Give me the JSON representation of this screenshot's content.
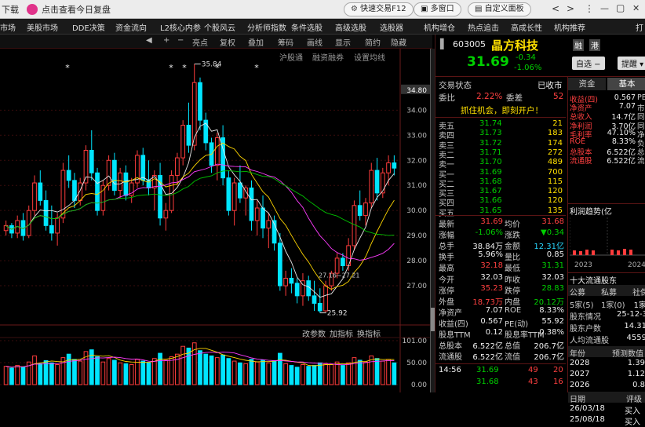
{
  "topbar": {
    "left_label": "下载",
    "promo_text": "点击查看今日复盘",
    "quick_trade": "快速交易F12",
    "multi_window": "多窗口",
    "custom_panel": "自定义面板",
    "nav_back": "<",
    "nav_fwd": ">",
    "more": "⋮",
    "minimize": "—",
    "restore": "▢",
    "close": "✕"
  },
  "menubar": {
    "items": [
      "市场",
      "美股市场",
      "DDE决策",
      "资金流向",
      "L2核心内参",
      "个股风云",
      "分析师指数",
      "条件选股",
      "高级选股",
      "选股器",
      "机构增仓",
      "热点追击",
      "高成长性",
      "机构推荐",
      "打"
    ]
  },
  "chart_toolbar": {
    "left_arrow": "◀",
    "plus": "+",
    "minus": "−",
    "bright_point": "亮点",
    "adjust": "复权",
    "overlay": "叠加",
    "chips": "筹码",
    "draw_line": "画线",
    "display": "显示",
    "simplified": "简约",
    "hide_indicator": "隐藏"
  },
  "chart_subbar": {
    "sh_connect": "沪股通",
    "margin_trading": "融资融券",
    "set_ma": "设置均线"
  },
  "chart_annotations": {
    "high_label": "35.84",
    "low_label": "25.92",
    "range_label": "27.16~27.21",
    "markers": [
      "*",
      "*",
      "*",
      "*",
      "*"
    ]
  },
  "indicator_bar": {
    "change_params": "改参数",
    "add_indicator": "加指标",
    "switch_indicator": "换指标"
  },
  "chart_data": {
    "type": "candlestick",
    "y_axis_price": [
      "34.80",
      "34.00",
      "33.00",
      "32.00",
      "31.00",
      "30.00",
      "29.00",
      "28.00",
      "27.00"
    ],
    "y_axis_volume": [
      "101.00",
      "50.00",
      "0.00"
    ],
    "current_price_tag": "34.80",
    "ylim": [
      25.5,
      35.2
    ],
    "candles": [
      [
        29.2,
        29.6,
        29.0,
        29.4
      ],
      [
        29.4,
        29.5,
        28.9,
        29.1
      ],
      [
        29.1,
        29.8,
        28.9,
        29.6
      ],
      [
        29.6,
        29.9,
        28.8,
        29.0
      ],
      [
        29.0,
        30.2,
        28.9,
        30.0
      ],
      [
        30.0,
        31.4,
        29.8,
        31.1
      ],
      [
        31.1,
        31.6,
        30.2,
        30.4
      ],
      [
        30.4,
        30.8,
        29.2,
        29.4
      ],
      [
        29.4,
        30.2,
        28.8,
        29.1
      ],
      [
        29.1,
        29.9,
        28.6,
        29.7
      ],
      [
        29.7,
        31.9,
        29.5,
        31.6
      ],
      [
        31.6,
        32.2,
        30.9,
        31.2
      ],
      [
        31.2,
        31.5,
        30.1,
        30.4
      ],
      [
        30.4,
        31.3,
        30.2,
        31.1
      ],
      [
        31.1,
        32.6,
        30.8,
        32.4
      ],
      [
        32.4,
        33.2,
        31.2,
        31.5
      ],
      [
        31.5,
        31.7,
        29.8,
        30.0
      ],
      [
        30.0,
        31.2,
        29.8,
        31.0
      ],
      [
        31.0,
        32.2,
        30.8,
        32.0
      ],
      [
        32.0,
        32.3,
        30.6,
        30.8
      ],
      [
        30.8,
        31.7,
        30.5,
        31.5
      ],
      [
        31.5,
        31.8,
        30.4,
        30.6
      ],
      [
        30.6,
        31.3,
        30.3,
        31.1
      ],
      [
        31.1,
        32.4,
        30.9,
        32.2
      ],
      [
        32.2,
        32.5,
        31.0,
        31.2
      ],
      [
        31.2,
        32.0,
        30.6,
        30.9
      ],
      [
        30.9,
        31.6,
        30.0,
        31.4
      ],
      [
        31.4,
        31.9,
        29.4,
        29.7
      ],
      [
        29.7,
        30.3,
        29.2,
        30.0
      ],
      [
        30.0,
        31.6,
        29.9,
        31.4
      ],
      [
        31.4,
        32.3,
        31.0,
        32.1
      ],
      [
        32.1,
        33.6,
        31.8,
        33.4
      ],
      [
        33.4,
        34.3,
        32.3,
        32.6
      ],
      [
        32.6,
        35.84,
        32.4,
        35.1
      ],
      [
        35.1,
        35.3,
        33.2,
        33.6
      ],
      [
        33.6,
        33.9,
        32.4,
        32.7
      ],
      [
        32.7,
        32.9,
        31.5,
        31.8
      ],
      [
        31.8,
        33.1,
        31.2,
        32.9
      ],
      [
        32.9,
        33.4,
        31.0,
        31.3
      ],
      [
        31.3,
        31.6,
        29.8,
        30.0
      ],
      [
        30.0,
        31.3,
        29.4,
        31.1
      ],
      [
        31.1,
        31.8,
        30.3,
        30.5
      ],
      [
        30.5,
        31.0,
        29.8,
        30.9
      ],
      [
        30.9,
        31.2,
        29.2,
        29.6
      ],
      [
        29.6,
        30.4,
        29.0,
        30.1
      ],
      [
        30.1,
        30.6,
        28.9,
        29.3
      ],
      [
        29.3,
        29.9,
        28.5,
        29.6
      ],
      [
        29.6,
        29.8,
        28.4,
        28.7
      ],
      [
        28.7,
        29.1,
        26.8,
        27.0
      ],
      [
        27.0,
        27.6,
        26.6,
        27.3
      ],
      [
        27.3,
        27.7,
        26.7,
        27.1
      ],
      [
        27.1,
        27.3,
        26.3,
        26.6
      ],
      [
        26.6,
        27.5,
        26.2,
        27.2
      ],
      [
        27.2,
        27.4,
        26.4,
        26.6
      ],
      [
        26.6,
        27.2,
        26.0,
        26.3
      ],
      [
        26.3,
        26.9,
        25.92,
        26.0
      ],
      [
        26.0,
        27.2,
        25.95,
        27.0
      ],
      [
        27.0,
        27.6,
        26.8,
        27.5
      ],
      [
        27.5,
        28.3,
        27.3,
        28.1
      ],
      [
        28.1,
        28.3,
        27.6,
        27.8
      ],
      [
        27.8,
        28.9,
        27.6,
        28.6
      ],
      [
        28.6,
        30.4,
        28.4,
        30.2
      ],
      [
        30.2,
        30.8,
        29.6,
        29.8
      ],
      [
        29.8,
        30.5,
        29.4,
        30.3
      ],
      [
        30.3,
        31.9,
        30.1,
        31.6
      ],
      [
        31.6,
        32.1,
        30.4,
        30.7
      ],
      [
        30.7,
        31.7,
        30.5,
        31.5
      ],
      [
        31.5,
        32.2,
        31.0,
        31.9
      ],
      [
        31.9,
        32.2,
        31.4,
        31.69
      ]
    ],
    "volumes": [
      42,
      38,
      44,
      40,
      52,
      66,
      48,
      55,
      50,
      46,
      62,
      70,
      58,
      54,
      76,
      80,
      64,
      52,
      60,
      56,
      50,
      48,
      46,
      58,
      54,
      50,
      60,
      72,
      56,
      64,
      70,
      88,
      84,
      96,
      78,
      70,
      66,
      62,
      68,
      60,
      54,
      50,
      48,
      58,
      52,
      56,
      50,
      54,
      72,
      48,
      44,
      40,
      46,
      42,
      44,
      50,
      48,
      46,
      52,
      44,
      50,
      62,
      56,
      52,
      66,
      60,
      54,
      58,
      50
    ]
  },
  "stock": {
    "code": "603005",
    "name": "晶方科技",
    "tag_rong": "融",
    "tag_hk": "港",
    "price": "31.69",
    "change": "-0.34",
    "change_pct": "-1.06%",
    "watch_btn": "自选 −",
    "remind_btn": "提醒 ▾",
    "trade_status_label": "交易状态",
    "trade_status": "已收市",
    "weibi_label": "委比",
    "weibi": "2.22%",
    "weicha_label": "委差",
    "weicha": "52",
    "promo": "抓住机会，即刻开户！"
  },
  "order_book": [
    {
      "label": "卖五",
      "price": "31.74",
      "vol": "21"
    },
    {
      "label": "卖四",
      "price": "31.73",
      "vol": "183"
    },
    {
      "label": "卖三",
      "price": "31.72",
      "vol": "174"
    },
    {
      "label": "卖二",
      "price": "31.71",
      "vol": "272"
    },
    {
      "label": "卖一",
      "price": "31.70",
      "vol": "489"
    },
    {
      "label": "买一",
      "price": "31.69",
      "vol": "700"
    },
    {
      "label": "买二",
      "price": "31.68",
      "vol": "115"
    },
    {
      "label": "买三",
      "price": "31.67",
      "vol": "120"
    },
    {
      "label": "买四",
      "price": "31.66",
      "vol": "120"
    },
    {
      "label": "买五",
      "price": "31.65",
      "vol": "135"
    }
  ],
  "quote_rows": [
    {
      "l1": "最新",
      "v1": "31.69",
      "c1": "red",
      "l2": "均价",
      "v2": "31.68",
      "c2": "red"
    },
    {
      "l1": "涨幅",
      "v1": "-1.06%",
      "c1": "grn",
      "l2": "涨跌",
      "v2": "▼0.34",
      "c2": "grn"
    },
    {
      "l1": "总手",
      "v1": "38.84万",
      "c1": "wht",
      "l2": "金额",
      "v2": "12.31亿",
      "c2": "cyan"
    },
    {
      "l1": "换手",
      "v1": "5.96%",
      "c1": "wht",
      "l2": "量比",
      "v2": "0.85",
      "c2": "wht"
    },
    {
      "l1": "最高",
      "v1": "32.18",
      "c1": "red",
      "l2": "最低",
      "v2": "31.31",
      "c2": "grn"
    },
    {
      "l1": "今开",
      "v1": "32.03",
      "c1": "wht",
      "l2": "昨收",
      "v2": "32.03",
      "c2": "wht"
    },
    {
      "l1": "涨停",
      "v1": "35.23",
      "c1": "red",
      "l2": "跌停",
      "v2": "28.83",
      "c2": "grn"
    },
    {
      "l1": "外盘",
      "v1": "18.73万",
      "c1": "red",
      "l2": "内盘",
      "v2": "20.12万",
      "c2": "grn"
    },
    {
      "l1": "净资产",
      "v1": "7.07",
      "c1": "wht",
      "l2": "ROE",
      "v2": "8.33%",
      "c2": "wht"
    },
    {
      "l1": "收益(四)",
      "v1": "0.567",
      "c1": "wht",
      "l2": "PE(动)",
      "v2": "55.92",
      "c2": "wht"
    },
    {
      "l1": "股息TTM",
      "v1": "0.12",
      "c1": "wht",
      "l2": "股息率TTM",
      "v2": "0.38%",
      "c2": "wht"
    },
    {
      "l1": "总股本",
      "v1": "6.522亿",
      "c1": "wht",
      "l2": "总值",
      "v2": "206.7亿",
      "c2": "wht"
    },
    {
      "l1": "流通股",
      "v1": "6.522亿",
      "c1": "wht",
      "l2": "流值",
      "v2": "206.7亿",
      "c2": "wht"
    }
  ],
  "ticks": [
    {
      "time": "14:56",
      "price": "31.69",
      "vol": "49",
      "ind": "20"
    },
    {
      "time": "",
      "price": "31.68",
      "vol": "43",
      "ind": "16"
    }
  ],
  "side_panel": {
    "tab_funds": "资金",
    "tab_basic": "基本",
    "rows": [
      {
        "l": "收益(四)",
        "v": "0.567",
        "r": "PE"
      },
      {
        "l": "净资产",
        "v": "7.07",
        "r": "市"
      },
      {
        "l": "总收入",
        "v": "14.7亿",
        "r": "同"
      },
      {
        "l": "净利润",
        "v": "3.70亿",
        "r": "同"
      },
      {
        "l": "毛利率",
        "v": "47.10%",
        "r": "净"
      },
      {
        "l": "ROE",
        "v": "8.33%",
        "r": "负"
      },
      {
        "l": "总股本",
        "v": "6.522亿",
        "r": "总"
      },
      {
        "l": "流通股",
        "v": "6.522亿",
        "r": "流"
      }
    ],
    "profit_title": "利润趋势(亿",
    "profit_years": [
      "2023",
      "2024"
    ],
    "holders_title": "十大流通股东",
    "holder_tabs": [
      "公募",
      "私募",
      "社保"
    ],
    "holders_rows": [
      {
        "l": "5家(5)",
        "m": "1家(0)",
        "r": "1家"
      },
      {
        "l": "股东情况",
        "m": "",
        "r": "25-12-3"
      },
      {
        "l": "股东户数",
        "m": "",
        "r": "14.31"
      },
      {
        "l": "人均流通股",
        "m": "",
        "r": "4559"
      }
    ],
    "eps_header": [
      "年份",
      "预测数值"
    ],
    "eps_rows": [
      {
        "y": "2028",
        "v": "1.39"
      },
      {
        "y": "2027",
        "v": "1.12"
      },
      {
        "y": "2026",
        "v": "0.8"
      }
    ],
    "rating_header": [
      "日期",
      "评级"
    ],
    "rating_rows": [
      {
        "d": "26/03/18",
        "v": "买入"
      },
      {
        "d": "25/08/18",
        "v": "买入"
      }
    ]
  },
  "colors": {
    "up": "#ff3c3c",
    "down": "#00e5ff",
    "ma_white": "#e8e8e8",
    "ma_yellow": "#ffd600",
    "ma_magenta": "#ff3cff",
    "ma_green": "#00c000"
  }
}
